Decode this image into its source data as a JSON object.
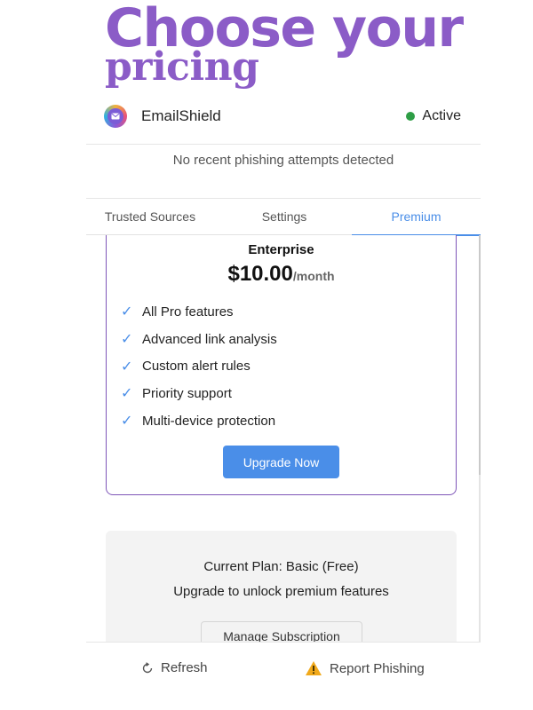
{
  "headline": {
    "line1": "Choose your",
    "line2": "pricing"
  },
  "app": {
    "name": "EmailShield",
    "status": "Active",
    "status_color": "#2e9e46",
    "logo_icon": "mail-icon"
  },
  "notice": "No recent phishing attempts detected",
  "tabs": [
    {
      "label": "Trusted Sources",
      "active": false
    },
    {
      "label": "Settings",
      "active": false
    },
    {
      "label": "Premium",
      "active": true
    }
  ],
  "plan": {
    "name": "Enterprise",
    "price": "$10.00",
    "period": "/month",
    "check_icon": "✓",
    "features": [
      "All Pro features",
      "Advanced link analysis",
      "Custom alert rules",
      "Priority support",
      "Multi-device protection"
    ],
    "cta": "Upgrade Now"
  },
  "current": {
    "plan_text": "Current Plan: Basic (Free)",
    "subtext": "Upgrade to unlock premium features",
    "button": "Manage Subscription"
  },
  "footer": {
    "refresh": {
      "label": "Refresh",
      "icon": "refresh-icon"
    },
    "report": {
      "label": "Report Phishing",
      "icon": "warning-icon"
    }
  },
  "colors": {
    "accent": "#4a8ee8",
    "headline": "#8b5cc7",
    "card_border": "#7e55b8"
  }
}
